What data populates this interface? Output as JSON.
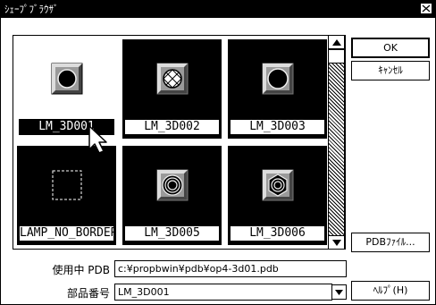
{
  "window": {
    "title": "ｼｪｰﾌﾟﾌﾞﾗｳｻﾞ"
  },
  "buttons": {
    "ok": "OK",
    "cancel": "ｷｬﾝｾﾙ",
    "pdb_file": "PDBﾌｧｲﾙ...",
    "help": "ﾍﾙﾌﾟ(H)"
  },
  "shapes": [
    {
      "label": "LM_3D001",
      "icon": "round-lamp-icon",
      "selected": true
    },
    {
      "label": "LM_3D002",
      "icon": "crosshatch-lamp-icon",
      "selected": false
    },
    {
      "label": "LM_3D003",
      "icon": "large-round-lamp-icon",
      "selected": false
    },
    {
      "label": "LAMP_NO_BORDER",
      "icon": "dashed-border-lamp-icon",
      "selected": false
    },
    {
      "label": "LM_3D005",
      "icon": "ring-lamp-icon",
      "selected": false
    },
    {
      "label": "LM_3D006",
      "icon": "hex-ring-lamp-icon",
      "selected": false
    }
  ],
  "pdb": {
    "label": "使用中 PDB",
    "path": "c:¥propbwin¥pdb¥op4-3d01.pdb"
  },
  "part_number": {
    "label": "部品番号",
    "value": "LM_3D001"
  }
}
